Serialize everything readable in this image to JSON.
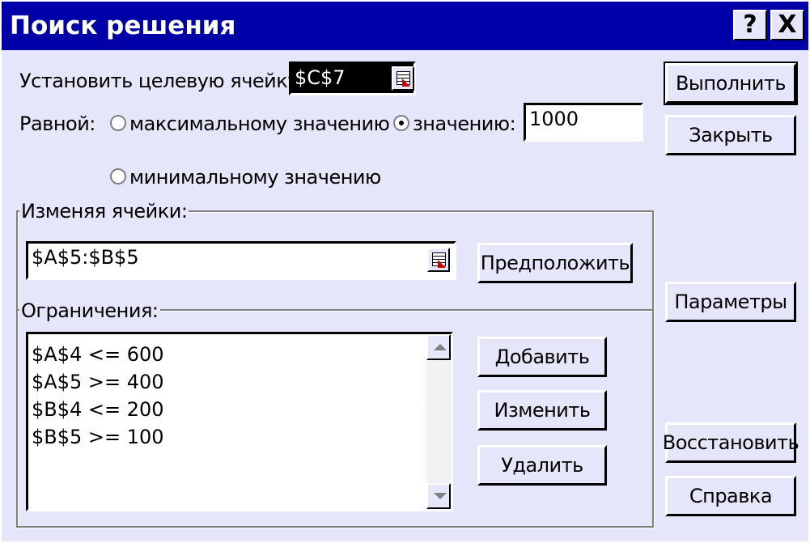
{
  "window": {
    "title": "Поиск решения",
    "help_glyph": "?",
    "close_glyph": "X"
  },
  "target": {
    "label": "Установить целевую ячейку:",
    "value": "$C$7"
  },
  "equal": {
    "label": "Равной:",
    "max_label": "максимальному значению",
    "value_label": "значению:",
    "value": "1000",
    "min_label": "минимальному значению",
    "selected": "value"
  },
  "changing": {
    "legend": "Изменяя ячейки:",
    "value": "$A$5:$B$5",
    "guess_label": "Предположить"
  },
  "constraints": {
    "legend": "Ограничения:",
    "items": [
      "$A$4 <= 600",
      "$A$5 >= 400",
      "$B$4 <= 200",
      "$B$5 >= 100"
    ],
    "add_label": "Добавить",
    "change_label": "Изменить",
    "delete_label": "Удалить"
  },
  "side_buttons": {
    "solve": "Выполнить",
    "close": "Закрыть",
    "options": "Параметры",
    "reset": "Восстановить",
    "help": "Справка"
  },
  "icons": {
    "help": "help-icon",
    "close": "close-icon",
    "ref": "range-select-icon",
    "scroll_up": "scroll-up-icon",
    "scroll_down": "scroll-down-icon"
  },
  "colors": {
    "titlebar": "#0000a8",
    "dialog_bg": "#e6e6fa"
  }
}
